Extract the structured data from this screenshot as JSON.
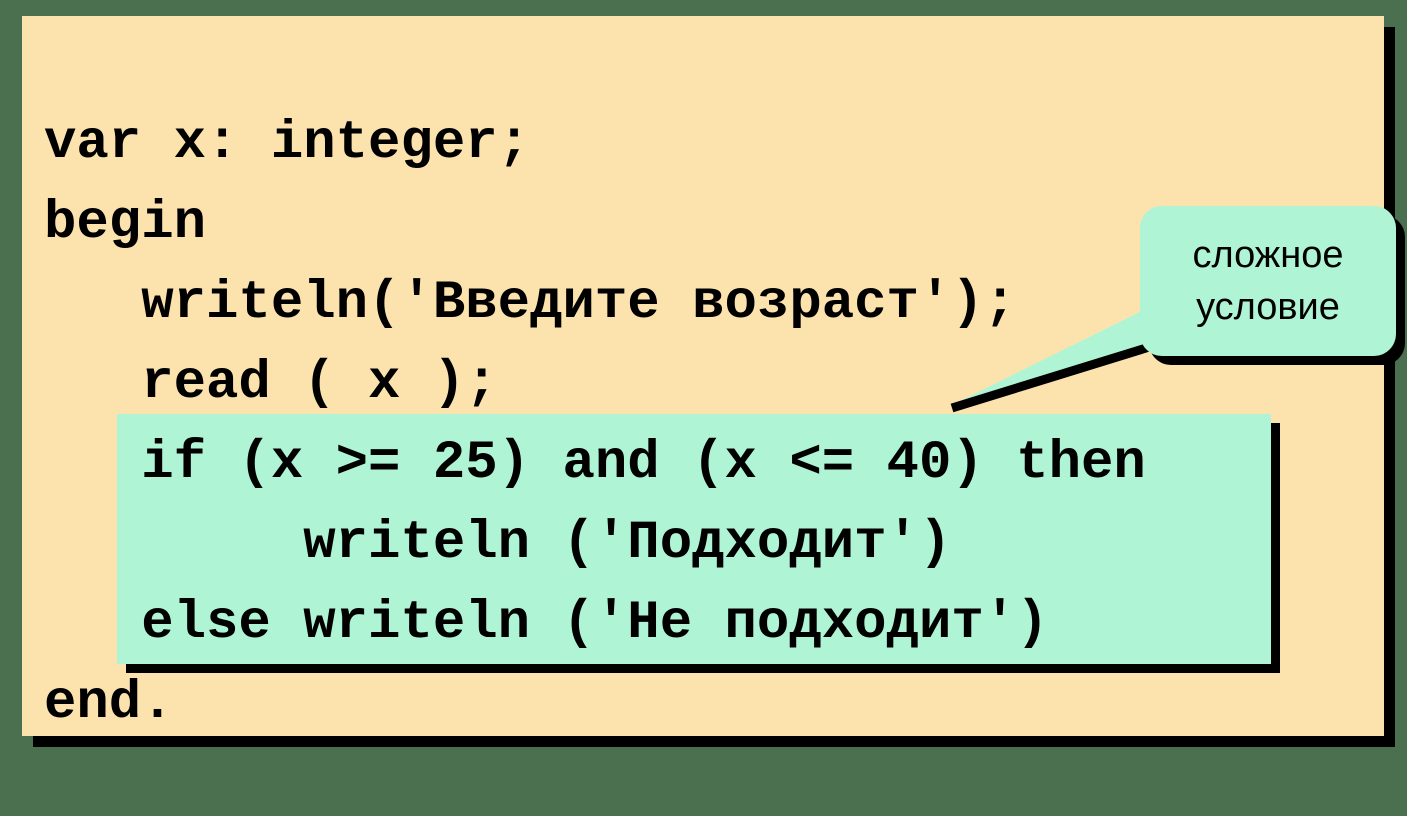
{
  "slide": {
    "background_color": "#fce3ad",
    "outer_color": "#4a7050",
    "shadow_color": "#000000",
    "highlight_color": "#aff5d5"
  },
  "code": {
    "language": "Pascal",
    "lines": [
      "var x: integer;",
      "begin",
      "   writeln('Введите возраст');",
      "   read ( x );",
      "   if (x >= 25) and (x <= 40) then",
      "        writeln ('Подходит')",
      "   else writeln ('Не подходит')",
      "end."
    ]
  },
  "highlight": {
    "label": "complex-condition-block",
    "lines": [
      "if (x >= 25) and (x <= 40) then",
      "     writeln ('Подходит')",
      "else writeln ('Не подходит')"
    ]
  },
  "callout": {
    "line1": "сложное",
    "line2": "условие",
    "fill_color": "#aff5d5"
  }
}
